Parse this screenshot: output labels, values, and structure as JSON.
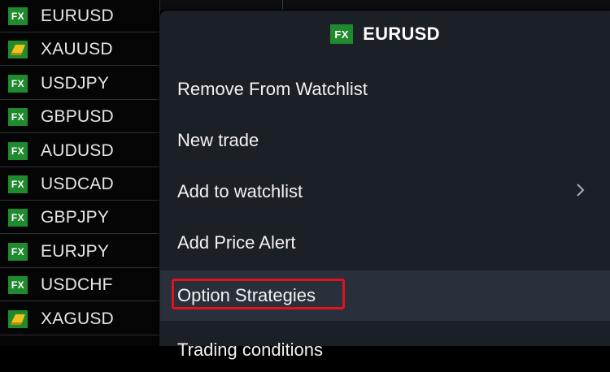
{
  "watchlist": {
    "items": [
      {
        "badge": "FX",
        "type": "fx",
        "symbol": "EURUSD"
      },
      {
        "badge": "",
        "type": "metal",
        "symbol": "XAUUSD"
      },
      {
        "badge": "FX",
        "type": "fx",
        "symbol": "USDJPY"
      },
      {
        "badge": "FX",
        "type": "fx",
        "symbol": "GBPUSD"
      },
      {
        "badge": "FX",
        "type": "fx",
        "symbol": "AUDUSD"
      },
      {
        "badge": "FX",
        "type": "fx",
        "symbol": "USDCAD"
      },
      {
        "badge": "FX",
        "type": "fx",
        "symbol": "GBPJPY"
      },
      {
        "badge": "FX",
        "type": "fx",
        "symbol": "EURJPY"
      },
      {
        "badge": "FX",
        "type": "fx",
        "symbol": "USDCHF"
      },
      {
        "badge": "",
        "type": "metal",
        "symbol": "XAGUSD"
      }
    ]
  },
  "context_menu": {
    "header": {
      "badge": "FX",
      "symbol": "EURUSD"
    },
    "items": [
      {
        "label": "Remove From Watchlist"
      },
      {
        "label": "New trade"
      },
      {
        "label": "Add to watchlist",
        "icon": "chevron-right-icon"
      },
      {
        "label": "Add Price Alert"
      },
      {
        "label": "Option Strategies",
        "highlighted": true
      },
      {
        "label": "Trading conditions"
      }
    ]
  },
  "colors": {
    "fx_badge": "#1f8a2e",
    "menu_bg": "#1b1f26",
    "menu_active": "#2a303b",
    "highlight": "#e0141e",
    "metal_gold": "#f2c21a"
  }
}
